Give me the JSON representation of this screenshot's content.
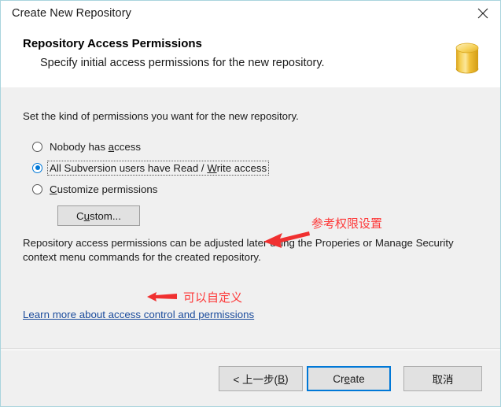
{
  "window": {
    "title": "Create New Repository",
    "close_icon": "close-icon",
    "border_color": "#a9d4dd"
  },
  "header": {
    "title": "Repository Access Permissions",
    "subtitle": "Specify initial access permissions for the new repository.",
    "icon": "repository-database-icon",
    "icon_color": "#f2c12e"
  },
  "body": {
    "intro": "Set the kind of permissions you want for the new repository.",
    "options": [
      {
        "label_before": "Nobody has ",
        "accel": "a",
        "label_after": "ccess",
        "checked": false,
        "focused": false
      },
      {
        "label_before": "All Subversion users have Read / ",
        "accel": "W",
        "label_after": "rite access",
        "checked": true,
        "focused": true
      },
      {
        "label_before": "",
        "accel": "C",
        "label_after": "ustomize permissions",
        "checked": false,
        "focused": false
      }
    ],
    "custom_button": {
      "label_before": "C",
      "accel": "u",
      "label_after": "stom..."
    },
    "note": "Repository access permissions can be adjusted later using the Properies or Manage Security context menu commands for the created repository.",
    "help_link": "Learn more about access control and permissions"
  },
  "footer": {
    "back_button": {
      "label_before": "< 上一步(",
      "accel": "B",
      "label_after": ")"
    },
    "create_button": {
      "label_before": "Cr",
      "accel": "e",
      "label_after": "ate",
      "focused": true,
      "focus_color": "#0078d7"
    },
    "cancel_button": {
      "label": "取消"
    }
  },
  "annotations": {
    "color": "#ff2a2a",
    "items": [
      {
        "text": "参考权限设置",
        "arrow": "left-arrow-icon"
      },
      {
        "text": "可以自定义",
        "arrow": "left-arrow-icon"
      }
    ]
  }
}
